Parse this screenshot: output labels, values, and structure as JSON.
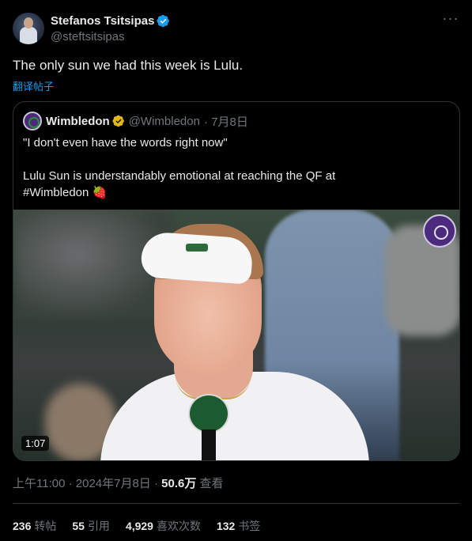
{
  "author": {
    "display_name": "Stefanos Tsitsipas",
    "handle": "@steftsitsipas",
    "avatar_icon": "player-avatar-icon",
    "verified_icon": "verified-badge-icon"
  },
  "more_label": "···",
  "tweet_text": "The only sun we had this week is Lulu.",
  "translate_label": "翻译帖子",
  "quote": {
    "display_name": "Wimbledon",
    "handle": "@Wimbledon",
    "date": "· 7月8日",
    "text_line1": "\"I don't even have the words right now\"",
    "text_line2": "Lulu Sun is understandably emotional at reaching the QF at",
    "text_line3": "#Wimbledon 🍓",
    "media_duration": "1:07"
  },
  "timestamp": {
    "time_date": "上午11:00 · 2024年7月8日 · ",
    "views_count": "50.6万",
    "views_label": " 查看"
  },
  "stats": [
    {
      "count": "236",
      "label": "转帖"
    },
    {
      "count": "55",
      "label": "引用"
    },
    {
      "count": "4,929",
      "label": "喜欢次数"
    },
    {
      "count": "132",
      "label": "书签"
    }
  ],
  "colors": {
    "background": "#000000",
    "text": "#e7e9ea",
    "muted": "#71767b",
    "link": "#1d9bf0",
    "border": "#2f3336",
    "verified_blue": "#1d9bf0",
    "verified_gold": "#e2b719"
  }
}
